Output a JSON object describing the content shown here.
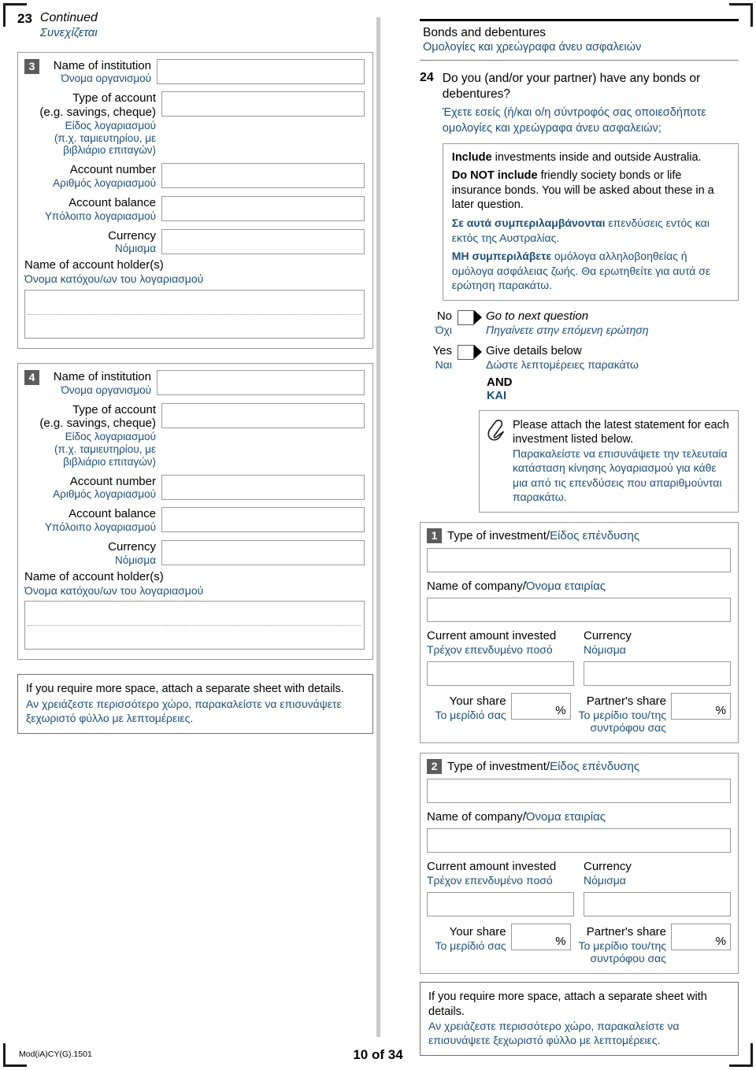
{
  "page": {
    "footer_code": "Mod(iA)CY(G).1501",
    "footer_page": "10 of 34"
  },
  "left": {
    "continued": {
      "number": "23",
      "en": "Continued",
      "gr": "Συνεχίζεται"
    },
    "blocks": [
      {
        "badge": "3",
        "fields": [
          {
            "en": "Name of institution",
            "gr": "Όνομα οργανισμού"
          },
          {
            "en": "Type of account\n(e.g. savings, cheque)",
            "gr": "Είδος λογαριασμού\n(π.χ. ταμιευτηρίου, με\nβιβλιάριο επιταγών)"
          },
          {
            "en": "Account number",
            "gr": "Αριθμός λογαριασμού"
          },
          {
            "en": "Account balance",
            "gr": "Υπόλοιπο λογαριασμού"
          },
          {
            "en": "Currency",
            "gr": "Νόμισμα"
          }
        ],
        "holder": {
          "en": "Name of account holder(s)",
          "gr": "Όνομα κατόχου/ων του λογαριασμού"
        }
      },
      {
        "badge": "4",
        "fields": [
          {
            "en": "Name of institution",
            "gr": "Όνομα οργανισμού"
          },
          {
            "en": "Type of account\n(e.g. savings, cheque)",
            "gr": "Είδος λογαριασμού\n(π.χ. ταμιευτηρίου, με\nβιβλιάριο επιταγών)"
          },
          {
            "en": "Account number",
            "gr": "Αριθμός λογαριασμού"
          },
          {
            "en": "Account balance",
            "gr": "Υπόλοιπο λογαριασμού"
          },
          {
            "en": "Currency",
            "gr": "Νόμισμα"
          }
        ],
        "holder": {
          "en": "Name of account holder(s)",
          "gr": "Όνομα κατόχου/ων του λογαριασμού"
        }
      }
    ],
    "more_space": {
      "en": "If you require more space, attach a separate sheet with details.",
      "gr": "Αν χρειάζεστε περισσότερο χώρο, παρακαλείστε να επισυνάψετε ξεχωριστό φύλλο με λεπτομέρειες."
    }
  },
  "right": {
    "section": {
      "en": "Bonds and debentures",
      "gr": "Ομολογίες και χρεώγραφα άνευ ασφαλειών"
    },
    "question": {
      "number": "24",
      "en": "Do you (and/or your partner) have any bonds or debentures?",
      "gr": "Έχετε εσείς (ή/και ο/η σύντροφός σας οποιεσδήποτε ομολογίες και χρεώγραφα άνευ ασφαλειών;"
    },
    "infobox": {
      "en_1_bold": "Include",
      "en_1_rest": " investments inside and outside Australia.",
      "en_2_bold": "Do NOT include",
      "en_2_rest": " friendly society bonds or life insurance bonds. You will be asked about these in a later question.",
      "gr_1_bold": "Σε αυτά συμπεριλαμβάνονται",
      "gr_1_rest": " επενδύσεις εντός και εκτός της Αυστραλίας.",
      "gr_2_bold": "ΜΗ συμπεριλάβετε",
      "gr_2_rest": " ομόλογα αλληλοβοηθείας ή ομόλογα ασφάλειας ζωής. Θα ερωτηθείτε για αυτά σε ερώτηση παρακάτω."
    },
    "answers": [
      {
        "label_en": "No",
        "label_gr": "Όχι",
        "action_en": "Go to next question",
        "action_gr": "Πηγαίνετε στην επόμενη ερώτηση"
      },
      {
        "label_en": "Yes",
        "label_gr": "Ναι",
        "action_en": "Give details below",
        "action_gr": "Δώστε λεπτομέρειες παρακάτω"
      }
    ],
    "and": {
      "en": "AND",
      "gr": "ΚΑΙ"
    },
    "attach": {
      "icon": "paperclip-icon",
      "en": "Please attach the latest statement for each investment listed below.",
      "gr": "Παρακαλείστε να επισυνάψετε την τελευταία κατάσταση κίνησης λογαριασμού για κάθε μια από τις επενδύσεις που απαριθμούνται παρακάτω."
    },
    "investments": [
      {
        "badge": "1",
        "type_en": "Type of investment/",
        "type_gr": "Είδος επένδυσης",
        "company_en": "Name of company/",
        "company_gr": "Όνομα εταιρίας",
        "amount_en": "Current amount invested",
        "amount_gr": "Τρέχον επενδυμένο ποσό",
        "currency_en": "Currency",
        "currency_gr": "Νόμισμα",
        "your_share_en": "Your share",
        "your_share_gr": "Το μερίδιό σας",
        "partner_share_en": "Partner's share",
        "partner_share_gr": "Το μερίδιο του/της συντρόφου σας",
        "pct": "%"
      },
      {
        "badge": "2",
        "type_en": "Type of investment/",
        "type_gr": "Είδος επένδυσης",
        "company_en": "Name of company/",
        "company_gr": "Όνομα εταιρίας",
        "amount_en": "Current amount invested",
        "amount_gr": "Τρέχον επενδυμένο ποσό",
        "currency_en": "Currency",
        "currency_gr": "Νόμισμα",
        "your_share_en": "Your share",
        "your_share_gr": "Το μερίδιό σας",
        "partner_share_en": "Partner's share",
        "partner_share_gr": "Το μερίδιο του/της συντρόφου σας",
        "pct": "%"
      }
    ],
    "more_space": {
      "en": "If you require more space, attach a separate sheet with details.",
      "gr": "Αν χρειάζεστε περισσότερο χώρο, παρακαλείστε να επισυνάψετε ξεχωριστό φύλλο με λεπτομέρειες."
    }
  }
}
